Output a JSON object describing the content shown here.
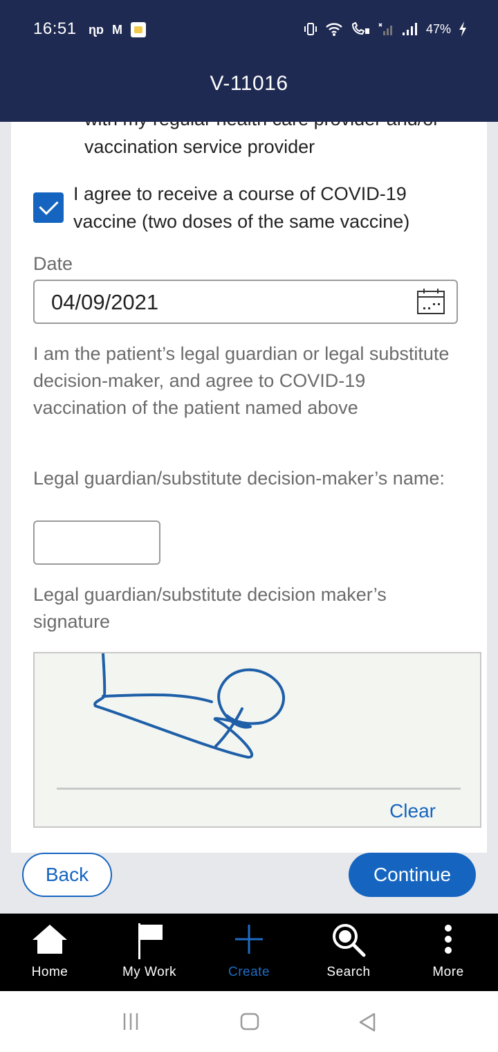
{
  "status_bar": {
    "time": "16:51",
    "battery": "47%"
  },
  "app_bar": {
    "title": "V-11016"
  },
  "form": {
    "previous_consent_text": "with my regular health care provider and/or vaccination service provider",
    "consent_checkbox": {
      "label": "I agree to receive a course of COVID-19 vaccine (two doses of the same vaccine)",
      "checked": true
    },
    "date_label": "Date",
    "date_value": "04/09/2021",
    "guardian_statement": "I am the patient’s legal guardian or legal substitute decision-maker, and agree to COVID-19 vaccination of the patient named above",
    "guardian_name_label": "Legal guardian/substitute decision-maker’s name:",
    "guardian_name_value": "",
    "signature_label": "Legal guardian/substitute decision maker’s signature",
    "clear_label": "Clear"
  },
  "actions": {
    "back_label": "Back",
    "continue_label": "Continue"
  },
  "bottom_nav": {
    "items": [
      {
        "label": "Home",
        "icon": "home-icon"
      },
      {
        "label": "My Work",
        "icon": "flag-icon"
      },
      {
        "label": "Create",
        "icon": "plus-icon",
        "active": true
      },
      {
        "label": "Search",
        "icon": "search-icon"
      },
      {
        "label": "More",
        "icon": "more-icon"
      }
    ]
  },
  "colors": {
    "header": "#1f2a52",
    "accent": "#1565c0",
    "nav_active": "#1e6cc4"
  }
}
